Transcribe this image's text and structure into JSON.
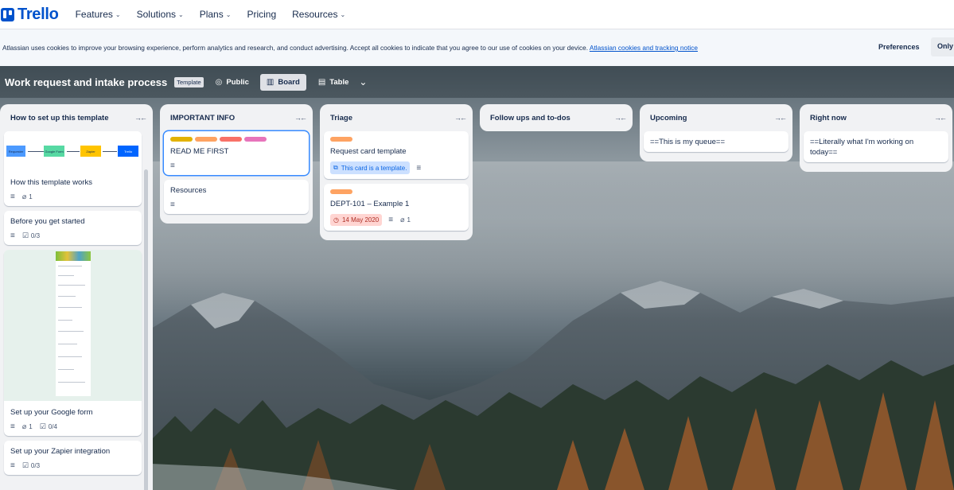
{
  "nav": {
    "logo": "Trello",
    "items": [
      {
        "label": "Features",
        "dropdown": true
      },
      {
        "label": "Solutions",
        "dropdown": true
      },
      {
        "label": "Plans",
        "dropdown": true
      },
      {
        "label": "Pricing",
        "dropdown": false
      },
      {
        "label": "Resources",
        "dropdown": true
      }
    ]
  },
  "cookie_banner": {
    "text": "Atlassian uses cookies to improve your browsing experience, perform analytics and research, and conduct advertising. Accept all cookies to indicate that you agree to our use of cookies on your device.",
    "link": "Atlassian cookies and tracking notice",
    "preferences": "Preferences",
    "only_necessary": "Only"
  },
  "board": {
    "title": "Work request and intake process",
    "template_badge": "Template",
    "visibility": "Public",
    "views": {
      "board": "Board",
      "table": "Table"
    }
  },
  "lists": [
    {
      "title": "How to set up this template",
      "flow_nodes": [
        "Requester",
        "Google Form",
        "Zapier",
        "Trello"
      ],
      "cards": [
        {
          "title": "How this template works",
          "attachments": "1"
        },
        {
          "title": "Before you get started",
          "checklist": "0/3"
        },
        {
          "title": "Set up your Google form",
          "attachments": "1",
          "checklist": "0/4"
        },
        {
          "title": "Set up your Zapier integration",
          "checklist": "0/3"
        }
      ]
    },
    {
      "title": "IMPORTANT INFO",
      "cards": [
        {
          "title": "READ ME FIRST",
          "labels": [
            "#e2b203",
            "#fea362",
            "#f87168",
            "#e774bb"
          ]
        },
        {
          "title": "Resources"
        }
      ]
    },
    {
      "title": "Triage",
      "cards": [
        {
          "title": "Request card template",
          "labels": [
            "#fea362"
          ],
          "template_badge": "This card is a template."
        },
        {
          "title": "DEPT-101 – Example 1",
          "labels": [
            "#fea362"
          ],
          "due": "14 May 2020",
          "attachments": "1"
        }
      ]
    },
    {
      "title": "Follow ups and to-dos",
      "cards": []
    },
    {
      "title": "Upcoming",
      "cards": [
        {
          "title": "==This is my queue=="
        }
      ]
    },
    {
      "title": "Right now",
      "cards": [
        {
          "title": "==Literally what I'm working on today=="
        }
      ]
    }
  ],
  "colors": {
    "brand": "#0052cc",
    "link": "#0052cc",
    "list_bg": "#f1f2f4"
  }
}
